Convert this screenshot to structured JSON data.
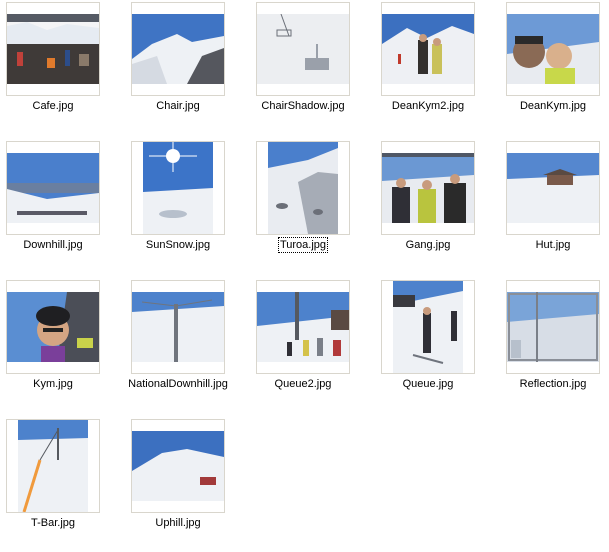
{
  "files": [
    {
      "name": "Cafe.jpg",
      "icon": "cafe-photo",
      "orientation": "landscape"
    },
    {
      "name": "Chair.jpg",
      "icon": "mountain-photo",
      "orientation": "landscape"
    },
    {
      "name": "ChairShadow.jpg",
      "icon": "shadow-photo",
      "orientation": "landscape"
    },
    {
      "name": "DeanKym2.jpg",
      "icon": "people-photo",
      "orientation": "landscape"
    },
    {
      "name": "DeanKym.jpg",
      "icon": "selfie-photo",
      "orientation": "landscape"
    },
    {
      "name": "Downhill.jpg",
      "icon": "downhill-photo",
      "orientation": "landscape"
    },
    {
      "name": "SunSnow.jpg",
      "icon": "sun-photo",
      "orientation": "portrait"
    },
    {
      "name": "Turoa.jpg",
      "icon": "turoa-photo",
      "orientation": "portrait",
      "focused": true
    },
    {
      "name": "Gang.jpg",
      "icon": "gang-photo",
      "orientation": "landscape"
    },
    {
      "name": "Hut.jpg",
      "icon": "hut-photo",
      "orientation": "landscape"
    },
    {
      "name": "Kym.jpg",
      "icon": "kym-photo",
      "orientation": "landscape"
    },
    {
      "name": "NationalDownhill.jpg",
      "icon": "lift-photo",
      "orientation": "landscape"
    },
    {
      "name": "Queue2.jpg",
      "icon": "queue2-photo",
      "orientation": "landscape"
    },
    {
      "name": "Queue.jpg",
      "icon": "queue-photo",
      "orientation": "portrait"
    },
    {
      "name": "Reflection.jpg",
      "icon": "reflect-photo",
      "orientation": "landscape"
    },
    {
      "name": "T-Bar.jpg",
      "icon": "tbar-photo",
      "orientation": "portrait"
    },
    {
      "name": "Uphill.jpg",
      "icon": "uphill-photo",
      "orientation": "landscape"
    }
  ],
  "colors": {
    "sky": "#3a6fb8",
    "snow": "#f2f4f7",
    "rock": "#4a4c55",
    "frame": "#d9d6cd",
    "focus_outline": "#000000"
  }
}
